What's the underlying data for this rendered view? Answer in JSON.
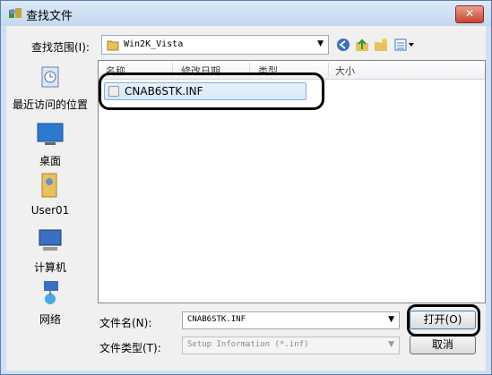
{
  "window": {
    "title": "查找文件",
    "close_glyph": "✕"
  },
  "lookin": {
    "label": "查找范围(I):",
    "value": "Win2K_Vista",
    "arrow": "▼"
  },
  "toolbar": {
    "back_icon": "back-arrow-icon",
    "up_icon": "up-folder-icon",
    "new_folder_icon": "new-folder-icon",
    "views_icon": "views-menu-icon"
  },
  "places": [
    {
      "label": "最近访问的位置",
      "icon": "recent-places-icon"
    },
    {
      "label": "桌面",
      "icon": "desktop-icon"
    },
    {
      "label": "User01",
      "icon": "user-folder-icon"
    },
    {
      "label": "计算机",
      "icon": "computer-icon"
    },
    {
      "label": "网络",
      "icon": "network-icon"
    }
  ],
  "columns": [
    "名称",
    "修改日期",
    "类型",
    "大小"
  ],
  "files": [
    {
      "name": "CNAB6STK.INF"
    }
  ],
  "filename": {
    "label": "文件名(N):",
    "value": "CNAB6STK.INF"
  },
  "filetype": {
    "label": "文件类型(T):",
    "value": "Setup Information (*.inf)"
  },
  "buttons": {
    "open": "打开(O)",
    "cancel": "取消"
  },
  "colors": {
    "title_bg": "#c3d8ef",
    "close_bg": "#c8442b",
    "selection": "#d5e7fa",
    "callout": "#000000"
  }
}
